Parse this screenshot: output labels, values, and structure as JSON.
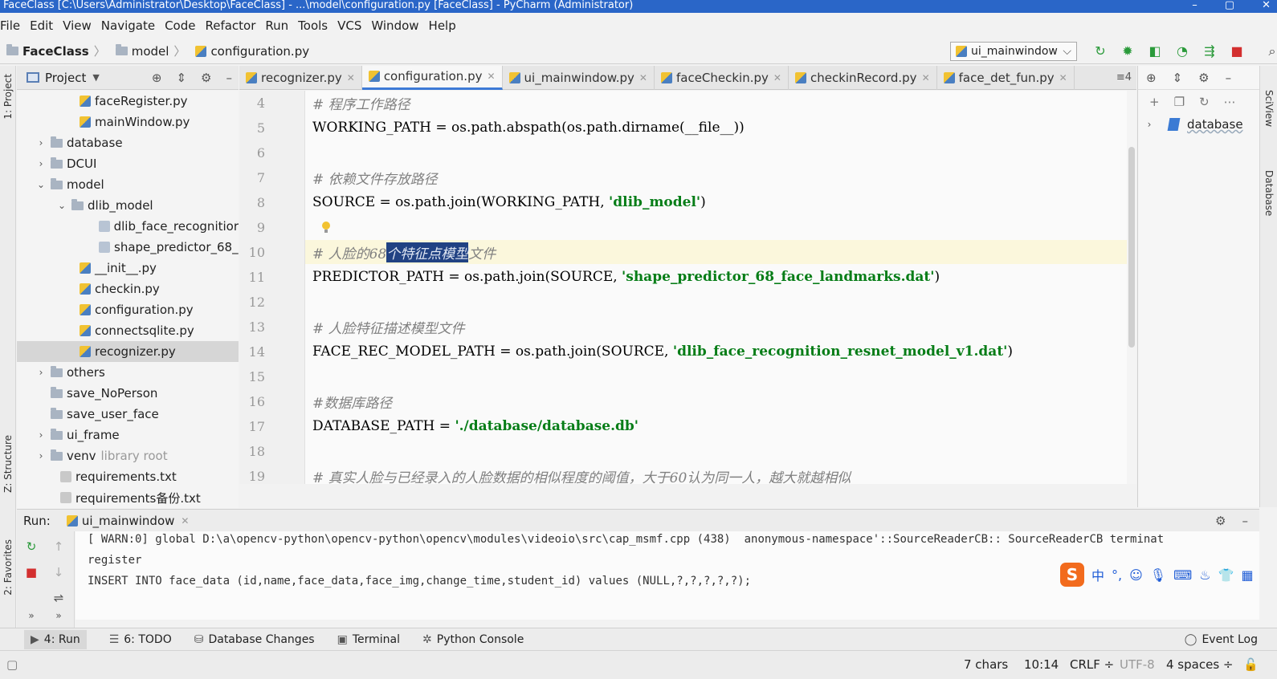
{
  "titlebar": {
    "text": "FaceClass [C:\\Users\\Administrator\\Desktop\\FaceClass] - ...\\model\\configuration.py [FaceClass] - PyCharm (Administrator)"
  },
  "menu": [
    "File",
    "Edit",
    "View",
    "Navigate",
    "Code",
    "Refactor",
    "Run",
    "Tools",
    "VCS",
    "Window",
    "Help"
  ],
  "breadcrumb": {
    "project": "FaceClass",
    "folder": "model",
    "file": "configuration.py"
  },
  "run_config": "ui_mainwindow",
  "project_panel": {
    "title": "Project",
    "tree": [
      {
        "label": "faceRegister.py",
        "type": "py"
      },
      {
        "label": "mainWindow.py",
        "type": "py"
      },
      {
        "label": "database",
        "type": "folder",
        "expanded": false
      },
      {
        "label": "DCUI",
        "type": "folder",
        "expanded": false
      },
      {
        "label": "model",
        "type": "folder",
        "expanded": true
      },
      {
        "label": "dlib_model",
        "type": "folder",
        "expanded": true
      },
      {
        "label": "dlib_face_recognitior",
        "type": "file"
      },
      {
        "label": "shape_predictor_68_",
        "type": "file"
      },
      {
        "label": "__init__.py",
        "type": "py"
      },
      {
        "label": "checkin.py",
        "type": "py"
      },
      {
        "label": "configuration.py",
        "type": "py"
      },
      {
        "label": "connectsqlite.py",
        "type": "py"
      },
      {
        "label": "recognizer.py",
        "type": "py",
        "selected": true
      },
      {
        "label": "others",
        "type": "folder",
        "expanded": false
      },
      {
        "label": "save_NoPerson",
        "type": "folder"
      },
      {
        "label": "save_user_face",
        "type": "folder"
      },
      {
        "label": "ui_frame",
        "type": "folder",
        "expanded": false
      },
      {
        "label": "venv",
        "type": "folder",
        "expanded": false,
        "suffix": "library root"
      },
      {
        "label": "requirements.txt",
        "type": "txt"
      },
      {
        "label": "requirements备份.txt",
        "type": "txt"
      }
    ]
  },
  "tabs": [
    {
      "label": "recognizer.py",
      "active": false
    },
    {
      "label": "configuration.py",
      "active": true
    },
    {
      "label": "ui_mainwindow.py",
      "active": false
    },
    {
      "label": "faceCheckin.py",
      "active": false
    },
    {
      "label": "checkinRecord.py",
      "active": false
    },
    {
      "label": "face_det_fun.py",
      "active": false
    }
  ],
  "tabs_overflow": "≡4",
  "editor": {
    "line_numbers": [
      "4",
      "5",
      "6",
      "7",
      "8",
      "9",
      "10",
      "11",
      "12",
      "13",
      "14",
      "15",
      "16",
      "17",
      "18",
      "19"
    ],
    "lines": {
      "l4": "# 程序工作路径",
      "l5": "WORKING_PATH = os.path.abspath(os.path.dirname(__file__))",
      "l7": "# 依赖文件存放路径",
      "l8_code": "SOURCE = os.path.join(WORKING_PATH, ",
      "l8_str": "'dlib_model'",
      "l8_end": ")",
      "l10_pre": "# 人脸的68",
      "l10_sel": "个特征点模型",
      "l10_post": "文件",
      "l11_code": "PREDICTOR_PATH = os.path.join(SOURCE, ",
      "l11_str": "'shape_predictor_68_face_landmarks.dat'",
      "l11_end": ")",
      "l13": "# 人脸特征描述模型文件",
      "l14_code": "FACE_REC_MODEL_PATH = os.path.join(SOURCE, ",
      "l14_str": "'dlib_face_recognition_resnet_model_v1.dat'",
      "l14_end": ")",
      "l16": "#数据库路径",
      "l17_code": "DATABASE_PATH = ",
      "l17_str": "'./database/database.db'",
      "l19": "# 真实人脸与已经录入的人脸数据的相似程度的阈值，大于60认为同一人，越大就越相似"
    }
  },
  "db_panel": {
    "node": "database"
  },
  "run_panel": {
    "label": "Run:",
    "tab": "ui_mainwindow",
    "console": [
      "[ WARN:0] global D:\\a\\opencv-python\\opencv-python\\opencv\\modules\\videoio\\src\\cap_msmf.cpp (438)  anonymous-namespace'::SourceReaderCB:: SourceReaderCB terminat",
      "register",
      "INSERT INTO face_data (id,name,face_data,face_img,change_time,student_id) values (NULL,?,?,?,?,?);"
    ]
  },
  "ime": {
    "logo": "S",
    "mode": "中"
  },
  "tool_windows": [
    {
      "label": "4: Run",
      "active": true
    },
    {
      "label": "6: TODO",
      "active": false
    },
    {
      "label": "Database Changes",
      "active": false
    },
    {
      "label": "Terminal",
      "active": false
    },
    {
      "label": "Python Console",
      "active": false
    }
  ],
  "event_log": "Event Log",
  "status": {
    "chars": "7 chars",
    "position": "10:14",
    "line_sep": "CRLF ÷",
    "encoding": "UTF-8",
    "indent": "4 spaces ÷"
  },
  "side_labels": {
    "project": "1: Project",
    "structure": "Z: Structure",
    "favorites": "2: Favorites",
    "sciview": "SciView",
    "database": "Database"
  },
  "colors": {
    "titlebar": "#2a66c8",
    "selection": "#214283",
    "current_line": "#fbf7dc",
    "string": "#067d17",
    "comment": "#808080"
  }
}
